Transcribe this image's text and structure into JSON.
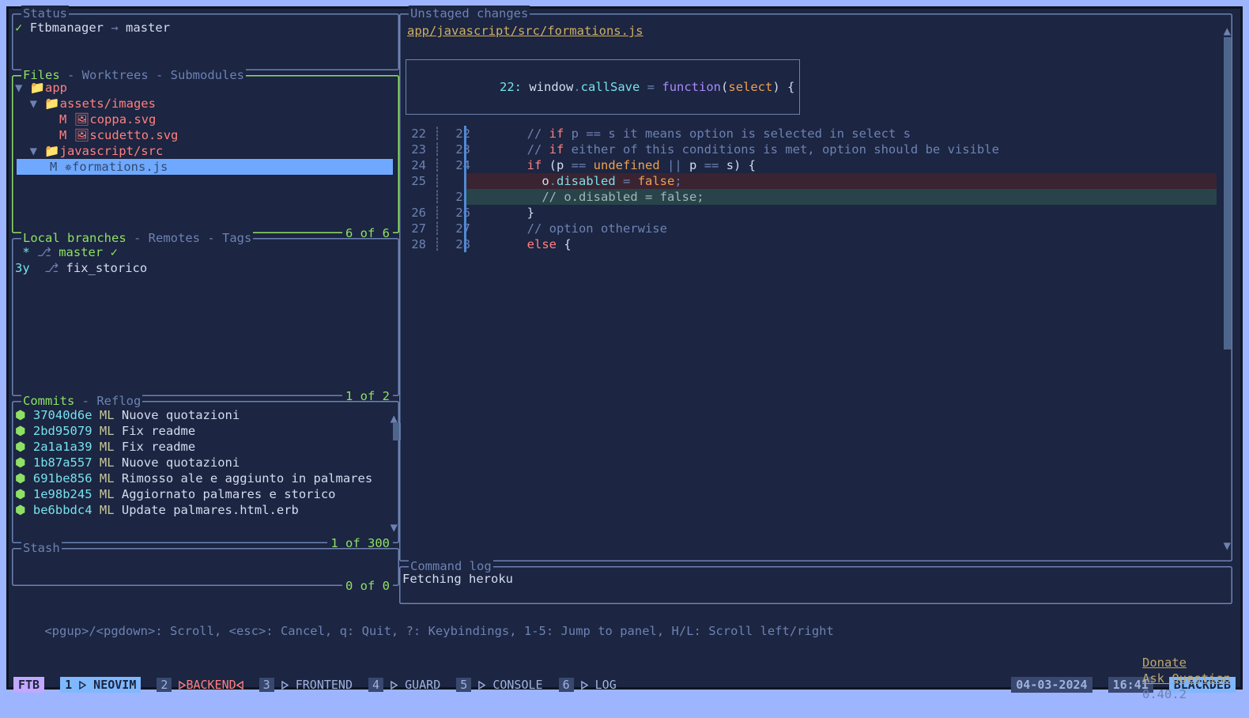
{
  "status": {
    "title": "Status",
    "check": "✓",
    "repo": "Ftbmanager",
    "arrow": "→",
    "branch": "master"
  },
  "files": {
    "tabs": [
      "Files",
      "Worktrees",
      "Submodules"
    ],
    "counter": "6 of 6",
    "tree": {
      "app": "app",
      "assets": "assets/images",
      "coppa_status": "M",
      "coppa": "coppa.svg",
      "scudetto_status": "M",
      "scudetto": "scudetto.svg",
      "jssrc": "javascript/src",
      "selected_status": "M",
      "selected_icon": "✵",
      "selected": "formations.js"
    }
  },
  "branches": {
    "tabs": [
      "Local branches",
      "Remotes",
      "Tags"
    ],
    "counter": "1 of 2",
    "items": [
      {
        "age": " *",
        "name": "master",
        "current": true
      },
      {
        "age": "3y",
        "name": "fix_storico",
        "current": false
      }
    ]
  },
  "commits": {
    "tabs": [
      "Commits",
      "Reflog"
    ],
    "counter": "1 of 300",
    "rows": [
      {
        "hash": "37040d6e",
        "author": "ML",
        "msg": "Nuove quotazioni"
      },
      {
        "hash": "2bd95079",
        "author": "ML",
        "msg": "Fix readme"
      },
      {
        "hash": "2a1a1a39",
        "author": "ML",
        "msg": "Fix readme"
      },
      {
        "hash": "1b87a557",
        "author": "ML",
        "msg": "Nuove quotazioni"
      },
      {
        "hash": "691be856",
        "author": "ML",
        "msg": "Rimosso ale e aggiunto in palmares"
      },
      {
        "hash": "1e98b245",
        "author": "ML",
        "msg": "Aggiornato palmares e storico"
      },
      {
        "hash": "be6bbdc4",
        "author": "ML",
        "msg": "Update palmares.html.erb"
      }
    ]
  },
  "stash": {
    "title": "Stash",
    "counter": "0 of 0"
  },
  "diff": {
    "title": "Unstaged changes",
    "file": "app/javascript/src/formations.js",
    "hunk": "22: window.callSave = function(select) {",
    "lines": [
      {
        "l": "22",
        "r": "22",
        "cls": "ctx",
        "txt": "        // if p == s it means option is selected in select s"
      },
      {
        "l": "23",
        "r": "23",
        "cls": "ctx",
        "txt": "        // if either of this conditions is met, option should be visible"
      },
      {
        "l": "24",
        "r": "24",
        "cls": "ctx",
        "txt": "        if (p == undefined || p == s) {"
      },
      {
        "l": "25",
        "r": "",
        "cls": "del",
        "txt": "          o.disabled = false;"
      },
      {
        "l": "",
        "r": "25",
        "cls": "add",
        "txt": "          // o.disabled = false;"
      },
      {
        "l": "26",
        "r": "26",
        "cls": "ctx",
        "txt": "        }"
      },
      {
        "l": "27",
        "r": "27",
        "cls": "ctx",
        "txt": "        // option otherwise"
      },
      {
        "l": "28",
        "r": "28",
        "cls": "ctx",
        "txt": "        else {"
      }
    ]
  },
  "cmdlog": {
    "title": "Command log",
    "line": "Fetching heroku"
  },
  "help": {
    "left": "<pgup>/<pgdown>: Scroll, <esc>: Cancel, q: Quit, ?: Keybindings, 1-5: Jump to panel, H/L: Scroll left/right",
    "donate": "Donate",
    "ask": "Ask Question",
    "version": "0.40.2"
  },
  "statusbar": {
    "ftb": "FTB",
    "items": [
      {
        "n": "1",
        "label": "NEOVIM",
        "active": true
      },
      {
        "n": "2",
        "label": "BACKEND",
        "running": true
      },
      {
        "n": "3",
        "label": "FRONTEND"
      },
      {
        "n": "4",
        "label": "GUARD"
      },
      {
        "n": "5",
        "label": "CONSOLE"
      },
      {
        "n": "6",
        "label": "LOG"
      }
    ],
    "date": "04-03-2024",
    "time": "16:41",
    "host": "BLACKDEB"
  }
}
